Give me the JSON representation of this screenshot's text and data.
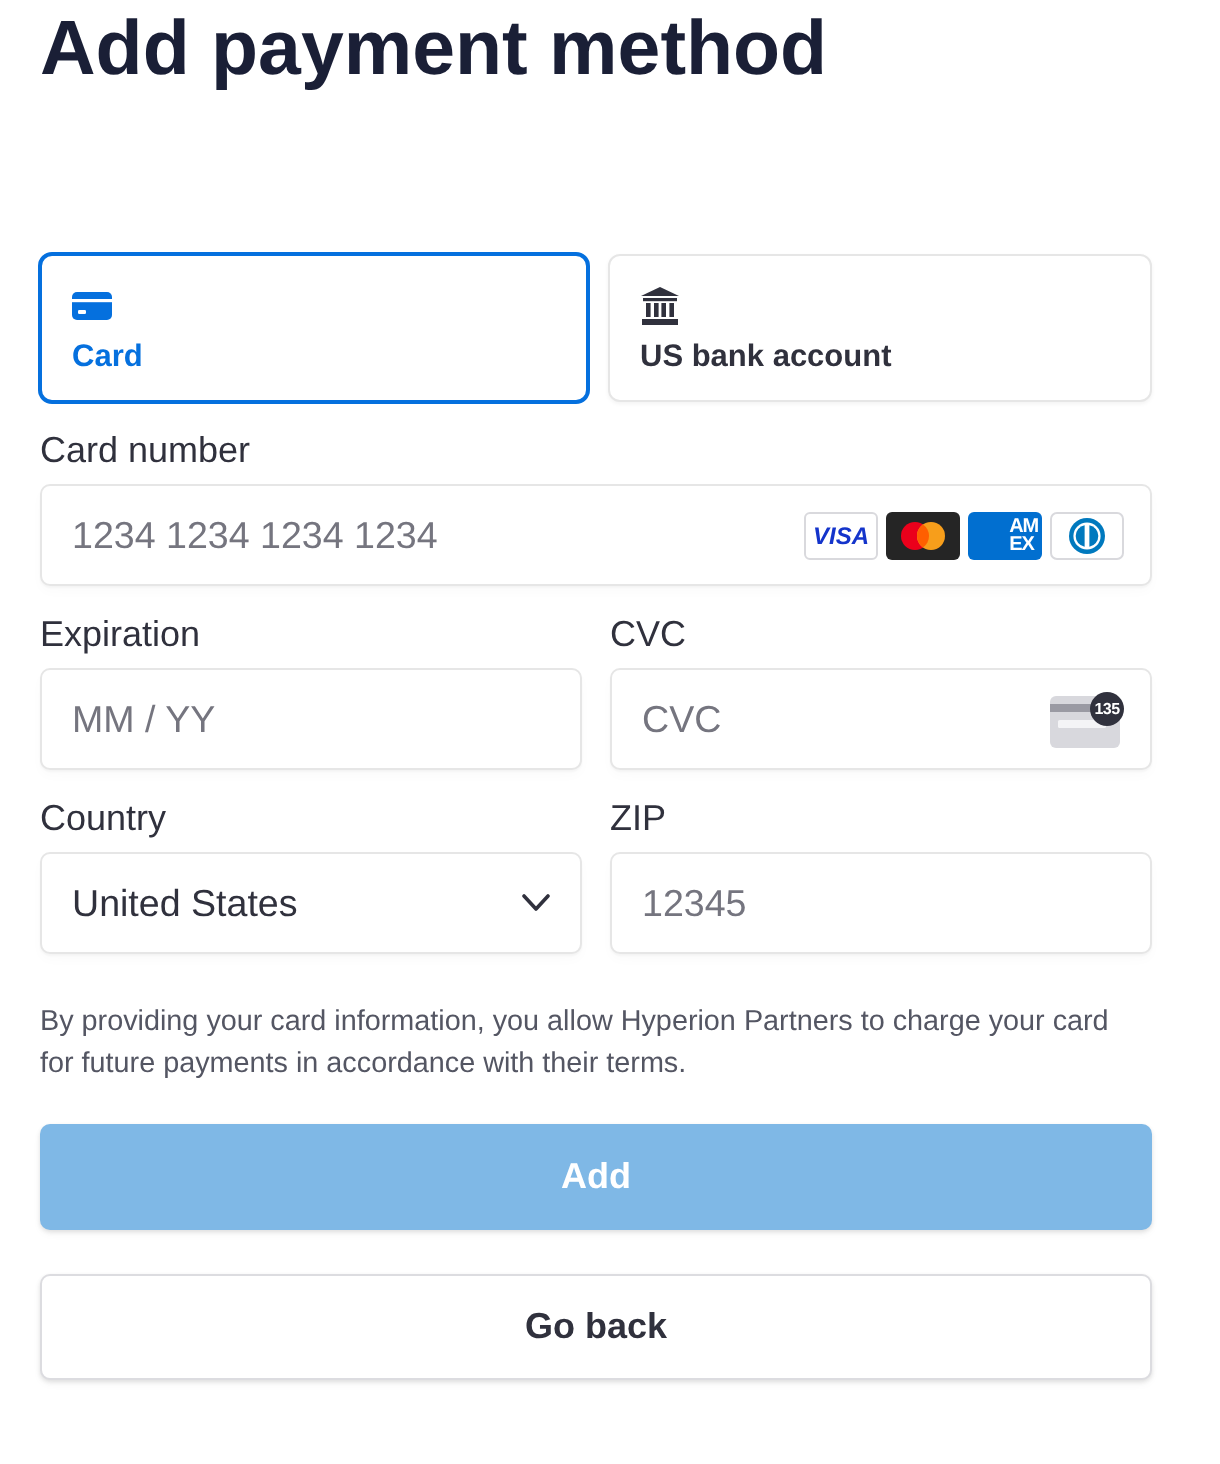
{
  "title": "Add payment method",
  "method_tabs": [
    {
      "kind": "card",
      "label": "Card",
      "selected": true
    },
    {
      "kind": "bank",
      "label": "US bank account",
      "selected": false
    }
  ],
  "card_number": {
    "label": "Card number",
    "placeholder": "1234 1234 1234 1234",
    "brands": [
      {
        "kind": "visa",
        "text": "VISA"
      },
      {
        "kind": "mastercard"
      },
      {
        "kind": "amex",
        "lines": [
          "AM",
          "EX"
        ]
      },
      {
        "kind": "diners"
      }
    ]
  },
  "expiration": {
    "label": "Expiration",
    "placeholder": "MM / YY"
  },
  "cvc": {
    "label": "CVC",
    "placeholder": "CVC",
    "hint_badge": "135"
  },
  "country": {
    "label": "Country",
    "value": "United States"
  },
  "zip": {
    "label": "ZIP",
    "placeholder": "12345"
  },
  "disclaimer": "By providing your card information, you allow Hyperion Partners to charge your card for future payments in accordance with their terms.",
  "buttons": [
    {
      "kind": "primary",
      "label": "Add",
      "disabled": true
    },
    {
      "kind": "secondary",
      "label": "Go back",
      "disabled": false
    }
  ]
}
